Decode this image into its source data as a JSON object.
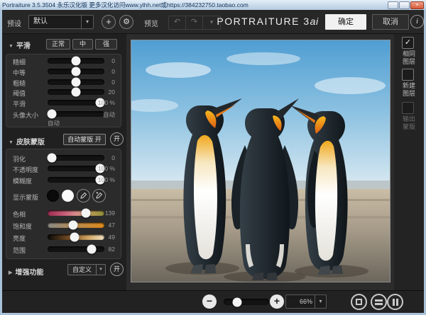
{
  "window": {
    "title": "Portraiture 3.5.3504 永乐汉化版   更多汉化访问www.ylhh.net或https://384232750.taobao.com",
    "close_glyph": "×"
  },
  "toolbar": {
    "preset_label": "预设",
    "preset_value": "默认",
    "add_icon": "+",
    "gear_icon": "⚙",
    "preview_label": "预览",
    "undo_icon": "↶",
    "redo_icon": "↷",
    "history_icon": "▾",
    "logo_main": "Portraiture 3",
    "logo_suffix": "ai",
    "ok_label": "确定",
    "cancel_label": "取消",
    "info_icon": "i"
  },
  "smoothing": {
    "title": "平滑",
    "collapse_icon": "▼",
    "presets": [
      {
        "label": "正常"
      },
      {
        "label": "中"
      },
      {
        "label": "强"
      }
    ],
    "sliders": [
      {
        "label": "精细",
        "value": "0"
      },
      {
        "label": "中等",
        "value": "0"
      },
      {
        "label": "粗糙",
        "value": "0"
      },
      {
        "label": "阈值",
        "value": "20"
      },
      {
        "label": "平滑",
        "value": "100 %"
      },
      {
        "label": "头像大小",
        "value": "自动",
        "sub": "自动"
      }
    ]
  },
  "skin_mask": {
    "title": "皮肤蒙版",
    "collapse_icon": "▼",
    "auto_mask_label": "自动蒙版 开",
    "toggle_label": "开",
    "sliders": [
      {
        "label": "羽化",
        "value": "0"
      },
      {
        "label": "不透明度",
        "value": "100 %"
      },
      {
        "label": "模糊度",
        "value": "100 %"
      }
    ],
    "show_mask_label": "显示蒙版",
    "color_sliders": [
      {
        "label": "色相",
        "value": "139"
      },
      {
        "label": "饱和度",
        "value": "47"
      },
      {
        "label": "亮度",
        "value": "49"
      },
      {
        "label": "范围",
        "value": "82"
      }
    ]
  },
  "enhance": {
    "title": "增强功能",
    "collapse_icon": "▶",
    "dropdown_value": "自定义",
    "chevron_icon": "▾",
    "toggle_label": "开"
  },
  "output_panel": {
    "items": [
      {
        "line1": "相同",
        "line2": "图层",
        "check": "✓"
      },
      {
        "line1": "新建",
        "line2": "图层",
        "check": ""
      },
      {
        "line1": "输出",
        "line2": "蒙版",
        "check": ""
      }
    ]
  },
  "bottom_bar": {
    "zoom_out_icon": "−",
    "zoom_in_icon": "+",
    "zoom_value": "66%",
    "chevron_icon": "▾"
  },
  "colors": {
    "app_bg": "#202020",
    "panel_bg": "#2b2b2b",
    "accent_orange": "#e8901c",
    "ok_button_bg": "#f1f1f1",
    "window_border": "#a9c2da"
  }
}
